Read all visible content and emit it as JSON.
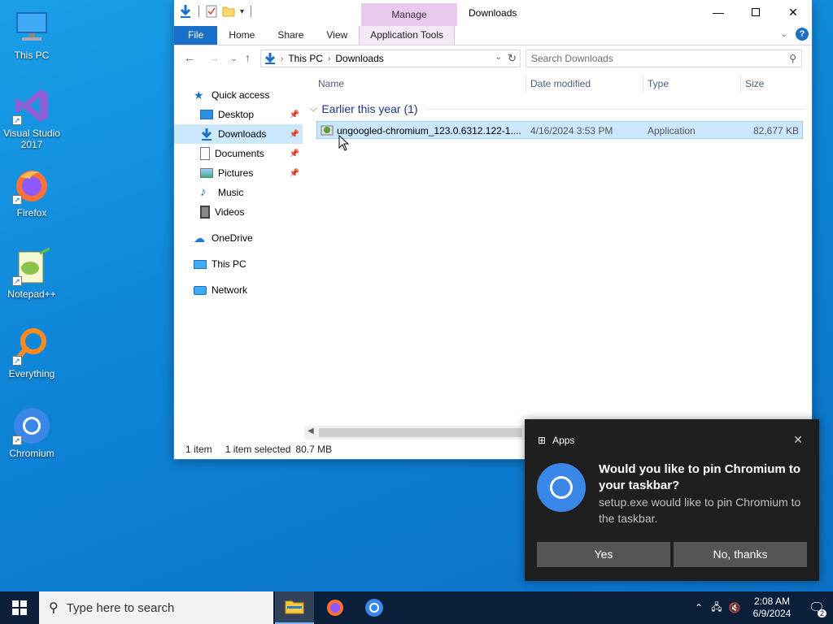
{
  "desktop": {
    "icons": [
      {
        "label": "This PC"
      },
      {
        "label": "Visual Studio 2017"
      },
      {
        "label": "Firefox"
      },
      {
        "label": "Notepad++"
      },
      {
        "label": "Everything"
      },
      {
        "label": "Chromium"
      }
    ]
  },
  "explorer": {
    "title": "Downloads",
    "manage_tab": "Manage",
    "ribbon_tabs": [
      "File",
      "Home",
      "Share",
      "View",
      "Application Tools"
    ],
    "address": {
      "crumbs": [
        "This PC",
        "Downloads"
      ]
    },
    "search_placeholder": "Search Downloads",
    "nav": {
      "quick_access": "Quick access",
      "items": [
        "Desktop",
        "Downloads",
        "Documents",
        "Pictures",
        "Music",
        "Videos"
      ],
      "onedrive": "OneDrive",
      "this_pc": "This PC",
      "network": "Network"
    },
    "columns": {
      "name": "Name",
      "date": "Date modified",
      "type": "Type",
      "size": "Size"
    },
    "group": "Earlier this year (1)",
    "files": [
      {
        "name": "ungoogled-chromium_123.0.6312.122-1....",
        "date": "4/16/2024 3:53 PM",
        "type": "Application",
        "size": "82,677 KB"
      }
    ],
    "status": {
      "count": "1 item",
      "selected": "1 item selected",
      "size": "80.7 MB"
    }
  },
  "toast": {
    "app": "Apps",
    "title": "Would you like to pin Chromium to your taskbar?",
    "body": "setup.exe would like to pin Chromium to the taskbar.",
    "yes": "Yes",
    "no": "No, thanks"
  },
  "taskbar": {
    "search_placeholder": "Type here to search",
    "time": "2:08 AM",
    "date": "6/9/2024",
    "notifications": "2"
  },
  "colors": {
    "accent": "#1a6fc9",
    "selection": "#cce8ff",
    "toast_bg": "#1f1f1f",
    "taskbar_bg": "#0b1f3a"
  }
}
